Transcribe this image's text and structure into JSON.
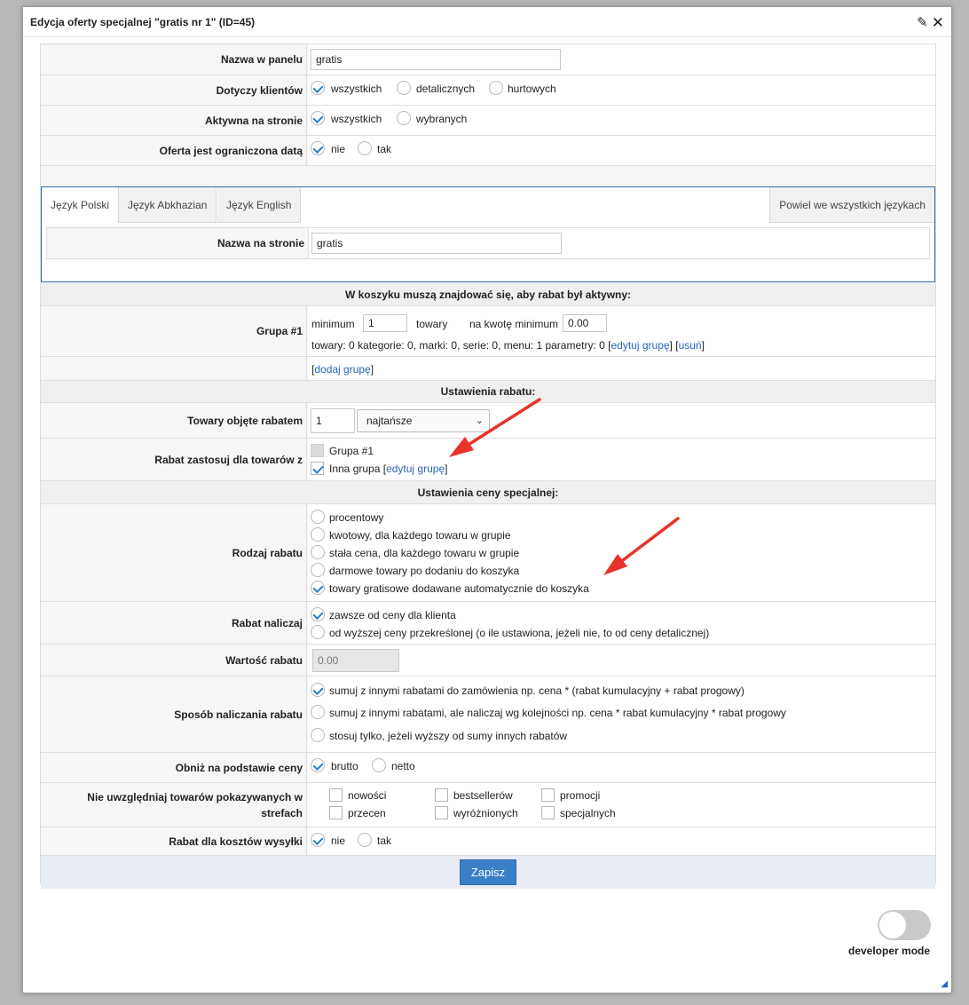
{
  "dialog": {
    "title": "Edycja oferty specjalnej \"gratis nr 1\" (ID=45)"
  },
  "general": {
    "panel_name_label": "Nazwa w panelu",
    "panel_name_value": "gratis",
    "clients_label": "Dotyczy klientów",
    "clients_options": [
      "wszystkich",
      "detalicznych",
      "hurtowych"
    ],
    "active_label": "Aktywna na stronie",
    "active_options": [
      "wszystkich",
      "wybranych"
    ],
    "date_label": "Oferta jest ograniczona datą",
    "date_options": [
      "nie",
      "tak"
    ]
  },
  "tabs": {
    "items": [
      "Język Polski",
      "Język Abkhazian",
      "Język English"
    ],
    "copy_all": "Powiel we wszystkich językach",
    "site_name_label": "Nazwa na stronie",
    "site_name_value": "gratis"
  },
  "cart": {
    "section_title": "W koszyku muszą znajdować się, aby rabat był aktywny:",
    "group_label": "Grupa #1",
    "minimum_label": "minimum",
    "minimum_value": "1",
    "towary_label": "towary",
    "amount_label": "na kwotę minimum",
    "amount_value": "0.00",
    "summary_text": "towary: 0 kategorie: 0, marki: 0, serie: 0, menu: 1 parametry: 0",
    "edit_group": "edytuj grupę",
    "remove": "usuń",
    "add_group": "dodaj grupę",
    "bracket_open": "[",
    "bracket_close": "]",
    "bracket_sep": "] ["
  },
  "discount": {
    "section_title": "Ustawienia rabatu:",
    "products_label": "Towary objęte rabatem",
    "products_count": "1",
    "products_sort": "najtańsze",
    "apply_label": "Rabat zastosuj dla towarów z",
    "apply_group1": "Grupa #1",
    "apply_other": "Inna grupa",
    "apply_other_edit": "edytuj grupę"
  },
  "price": {
    "section_title": "Ustawienia ceny specjalnej:",
    "type_label": "Rodzaj rabatu",
    "type_options": [
      "procentowy",
      "kwotowy, dla każdego towaru w grupie",
      "stała cena, dla każdego towaru w grupie",
      "darmowe towary po dodaniu do koszyka",
      "towary gratisowe dodawane automatycznie do koszyka"
    ],
    "calc_label": "Rabat naliczaj",
    "calc_options": [
      "zawsze od ceny dla klienta",
      "od wyższej ceny przekreślonej (o ile ustawiona, jeżeli nie, to od ceny detalicznej)"
    ],
    "value_label": "Wartość rabatu",
    "value_placeholder": "0.00",
    "method_label": "Sposób naliczania rabatu",
    "method_options": [
      "sumuj z innymi rabatami do zamówienia np. cena * (rabat kumulacyjny + rabat progowy)",
      "sumuj z innymi rabatami, ale naliczaj wg kolejności np. cena * rabat kumulacyjny * rabat progowy",
      "stosuj tylko, jeżeli wyższy od sumy innych rabatów"
    ],
    "lower_label": "Obniż na podstawie ceny",
    "lower_options": [
      "brutto",
      "netto"
    ],
    "exclude_label": "Nie uwzględniaj towarów pokazywanych w strefach",
    "exclude_options": [
      "nowości",
      "bestsellerów",
      "promocji",
      "przecen",
      "wyróżnionych",
      "specjalnych"
    ],
    "shipping_label": "Rabat dla kosztów wysyłki",
    "shipping_options": [
      "nie",
      "tak"
    ]
  },
  "actions": {
    "save": "Zapisz"
  },
  "developer": {
    "label": "developer mode"
  },
  "colors": {
    "accent": "#2d7fc2",
    "save_button": "#3a7fc8",
    "arrow": "#e8322b"
  }
}
